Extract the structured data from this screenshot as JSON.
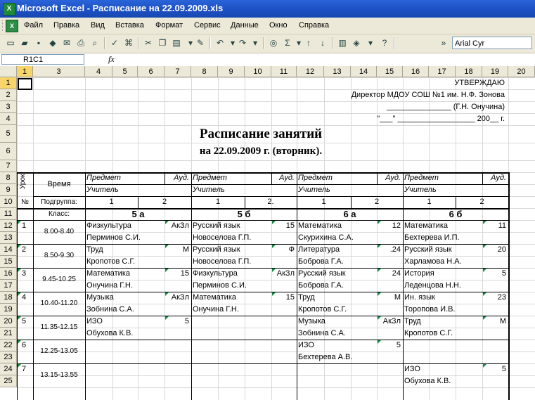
{
  "window": {
    "title": "Microsoft Excel - Расписание на 22.09.2009.xls"
  },
  "menu": [
    "Файл",
    "Правка",
    "Вид",
    "Вставка",
    "Формат",
    "Сервис",
    "Данные",
    "Окно",
    "Справка"
  ],
  "toolbar": {
    "font_name": "Arial Cyr"
  },
  "formula_bar": {
    "name_box": "R1C1",
    "fx": "fx",
    "content": ""
  },
  "columns": [
    "1",
    "3",
    "4",
    "5",
    "6",
    "7",
    "8",
    "9",
    "10",
    "11",
    "12",
    "13",
    "14",
    "15",
    "16",
    "17",
    "18",
    "19",
    "20"
  ],
  "rows": [
    "1",
    "2",
    "3",
    "4",
    "5",
    "6",
    "7",
    "8",
    "9",
    "10",
    "11",
    "12",
    "13",
    "14",
    "15",
    "16",
    "17",
    "18",
    "19",
    "20",
    "21",
    "22",
    "23",
    "24",
    "25"
  ],
  "header": {
    "approve": "УТВЕРЖДАЮ",
    "director": "Директор МДОУ СОШ №1 им. Н.Ф. Зонова",
    "sign": "_______________ (Г.Н. Онучина)",
    "date": "\"___\" __________________ 200__ г.",
    "title": "Расписание занятий",
    "subtitle": "на 22.09.2009 г. (вторник)."
  },
  "table_head": {
    "urok": "Урок",
    "time": "Время",
    "subject": "Предмет",
    "room": "Ауд.",
    "teacher": "Учитель",
    "num": "№",
    "subgroup": "Подгруппа:",
    "sub1": "1",
    "sub2": "2",
    "sub2b": "2.",
    "class_label": "Класс:",
    "classes": [
      "5 а",
      "5 б",
      "6 а",
      "6 б"
    ]
  },
  "lessons": [
    {
      "n": "1",
      "time": "8.00-8.40",
      "cells": [
        {
          "subject": "Физкультура",
          "room": "АкЗл",
          "teacher": "Перминов С.И."
        },
        {
          "subject": "Русский язык",
          "room": "15",
          "teacher": "Новоселова Г.П."
        },
        {
          "subject": "Математика",
          "room": "12",
          "teacher": "Скурихина С.А."
        },
        {
          "subject": "Математика",
          "room": "11",
          "teacher": "Бехтерева И.П."
        }
      ]
    },
    {
      "n": "2",
      "time": "8.50-9.30",
      "cells": [
        {
          "subject": "Труд",
          "room": "М",
          "teacher": "Кропотов С.Г."
        },
        {
          "subject": "Русский язык",
          "room": "Ф",
          "teacher": "Новоселова Г.П."
        },
        {
          "subject": "Литература",
          "room": ".24",
          "teacher": "Боброва Г.А."
        },
        {
          "subject": "Русский язык",
          "room": "20",
          "teacher": "Харламова Н.А."
        }
      ]
    },
    {
      "n": "3",
      "time": "9.45-10.25",
      "cells": [
        {
          "subject": "Математика",
          "room": "15",
          "teacher": "Онучина Г.Н."
        },
        {
          "subject": "Физкультура",
          "room": "АкЗл",
          "teacher": "Перминов С.И."
        },
        {
          "subject": "Русский язык",
          "room": "24",
          "teacher": "Боброва Г.А."
        },
        {
          "subject": "История",
          "room": "5",
          "teacher": "Леденцова Н.Н."
        }
      ]
    },
    {
      "n": "4",
      "time": "10.40-11.20",
      "cells": [
        {
          "subject": "Музыка",
          "room": "АкЗл",
          "teacher": "Зобнина С.А."
        },
        {
          "subject": "Математика",
          "room": "15",
          "teacher": "Онучина Г.Н."
        },
        {
          "subject": "Труд",
          "room": "М",
          "teacher": "Кропотов С.Г."
        },
        {
          "subject": "Ин. язык",
          "room": "23",
          "teacher": "Торопова И.В."
        }
      ]
    },
    {
      "n": "5",
      "time": "11.35-12.15",
      "cells": [
        {
          "subject": "ИЗО",
          "room": "5",
          "teacher": "Обухова К.В."
        },
        {
          "subject": "",
          "room": "",
          "teacher": ""
        },
        {
          "subject": "Музыка",
          "room": "АкЗл",
          "teacher": "Зобнина С.А."
        },
        {
          "subject": "Труд",
          "room": "М",
          "teacher": "Кропотов С.Г."
        }
      ]
    },
    {
      "n": "6",
      "time": "12.25-13.05",
      "cells": [
        {
          "subject": "",
          "room": "",
          "teacher": ""
        },
        {
          "subject": "",
          "room": "",
          "teacher": ""
        },
        {
          "subject": "ИЗО",
          "room": "5",
          "teacher": "Бехтерева А.В."
        },
        {
          "subject": "",
          "room": "",
          "teacher": ""
        }
      ]
    },
    {
      "n": "7",
      "time": "13.15-13.55",
      "cells": [
        {
          "subject": "",
          "room": "",
          "teacher": ""
        },
        {
          "subject": "",
          "room": "",
          "teacher": ""
        },
        {
          "subject": "",
          "room": "",
          "teacher": ""
        },
        {
          "subject": "ИЗО",
          "room": "5",
          "teacher": "Обухова К.В."
        }
      ]
    }
  ]
}
